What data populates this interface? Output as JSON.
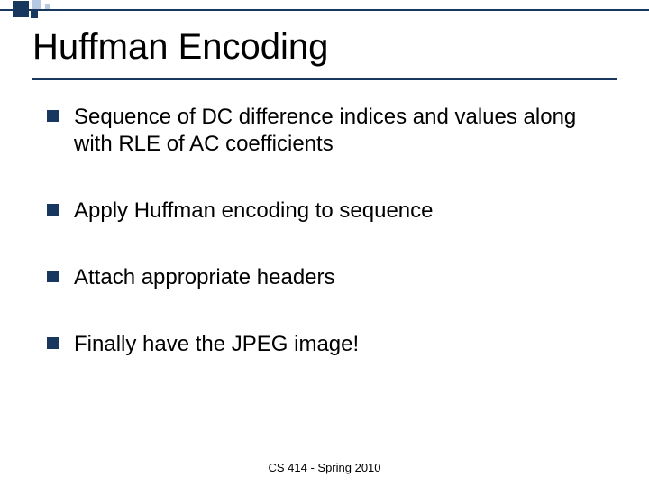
{
  "title": "Huffman Encoding",
  "bullets": [
    "Sequence of DC difference indices and values along with RLE of AC coefficients",
    "Apply Huffman encoding to sequence",
    "Attach appropriate headers",
    "Finally have the JPEG image!"
  ],
  "footer": "CS 414 - Spring 2010"
}
